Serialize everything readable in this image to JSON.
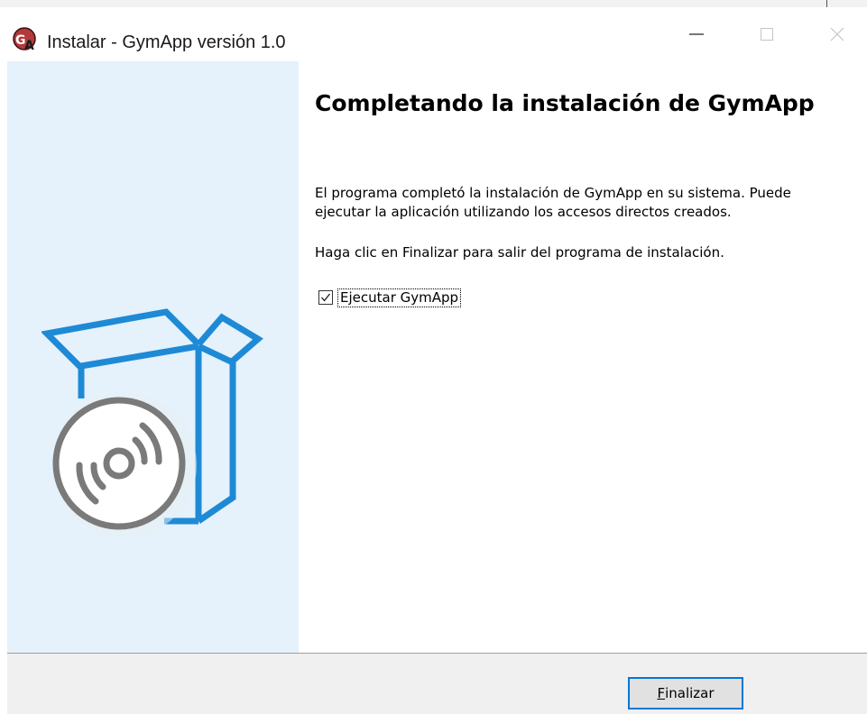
{
  "window": {
    "title": "Instalar - GymApp versión 1.0",
    "icon": "gymapp-logo-icon"
  },
  "content": {
    "heading": "Completando la instalación de GymApp",
    "paragraph1": "El programa completó la instalación de GymApp en su sistema. Puede ejecutar la aplicación utilizando los accesos directos creados.",
    "paragraph2": "Haga clic en Finalizar para salir del programa de instalación.",
    "run_checkbox": {
      "label": "Ejecutar GymApp",
      "checked": true
    }
  },
  "footer": {
    "finish_button": {
      "mnemonic": "F",
      "rest": "inalizar"
    }
  },
  "colors": {
    "side_panel": "#e5f1fb",
    "box_accent": "#1e8ad6",
    "disc_gray": "#7a7a7a",
    "button_border": "#0078d7"
  }
}
